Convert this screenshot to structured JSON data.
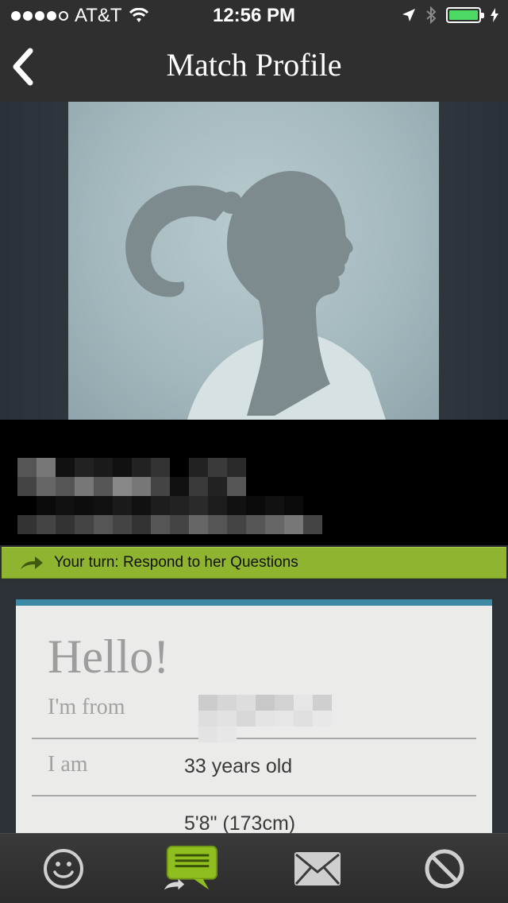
{
  "status_bar": {
    "carrier": "AT&T",
    "time": "12:56 PM",
    "battery_color": "#4cd964"
  },
  "nav": {
    "title": "Match Profile",
    "back_icon": "chevron-left-icon"
  },
  "turn_banner": {
    "text": "Your turn: Respond to her Questions",
    "icon": "arrow-right-icon",
    "color": "#8fb42f"
  },
  "profile_card": {
    "accent_color": "#3e8aa4",
    "heading": "Hello!",
    "rows": [
      {
        "label": "I'm from",
        "value": ""
      },
      {
        "label": "I am",
        "value": "33 years old"
      },
      {
        "label": "",
        "value": "5'8\" (173cm)"
      }
    ]
  },
  "tab_bar": {
    "tabs": [
      {
        "name": "smiley-icon"
      },
      {
        "name": "chat-icon",
        "active": true
      },
      {
        "name": "mail-icon"
      },
      {
        "name": "block-icon"
      }
    ],
    "active_color": "#8fbf1f"
  }
}
